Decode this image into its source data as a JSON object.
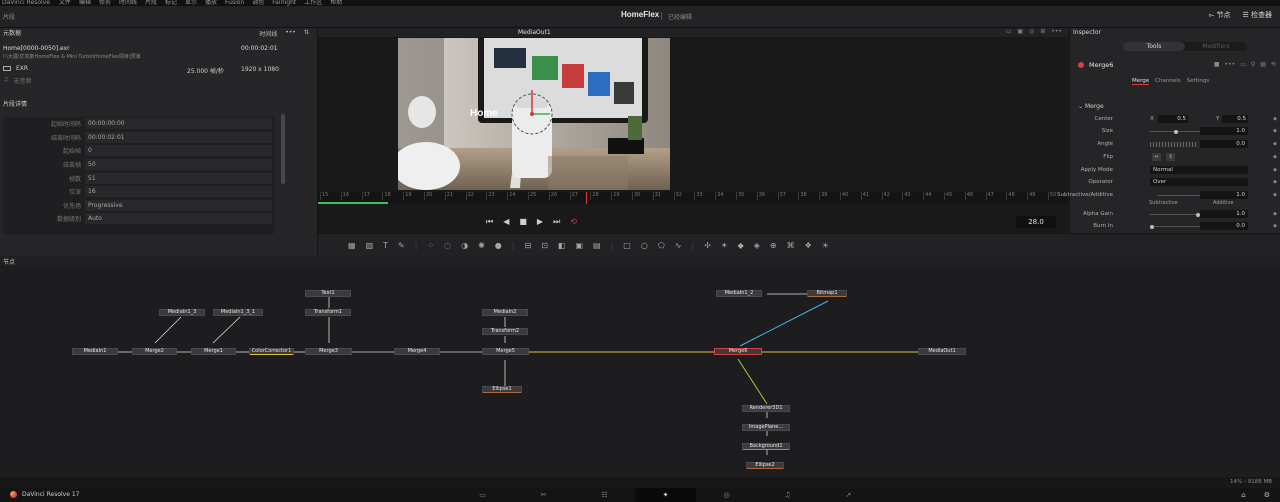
{
  "menubar": {
    "app": "DaVinci Resolve",
    "items": [
      "文件",
      "编辑",
      "修剪",
      "时间线",
      "片段",
      "标记",
      "显示",
      "播放",
      "Fusion",
      "调色",
      "Fairlight",
      "工作区",
      "帮助"
    ]
  },
  "titlebar": {
    "left_label": "片段",
    "project": "HomeFlex",
    "subtitle": "已经编辑",
    "nodes_label": "节点",
    "inspector_label": "检查器"
  },
  "metadata": {
    "title": "元数据",
    "timeline_label": "时间线",
    "clip_name": "Home[0000-0050].exr",
    "clip_timecode": "00:00:02:01",
    "path": "I:\\大疆\\优克斯HomeFlex & Mini Turbo\\HomeFlex项目\\预演",
    "format": "EXR",
    "fps": "25.000 帧/秒",
    "resolution": "1920 x 1080",
    "audio": "无音频",
    "details_title": "片段详情",
    "rows": [
      {
        "k": "起始时间码",
        "v": "00:00:00:00"
      },
      {
        "k": "结束时间码",
        "v": "00:00:02:01"
      },
      {
        "k": "起始帧",
        "v": "0"
      },
      {
        "k": "结束帧",
        "v": "50"
      },
      {
        "k": "帧数",
        "v": "51"
      },
      {
        "k": "位深",
        "v": "16"
      },
      {
        "k": "优先场",
        "v": "Progressive"
      },
      {
        "k": "数据级别",
        "v": "Auto"
      }
    ]
  },
  "viewer": {
    "name": "MediaOut1",
    "overlay_text": "Home",
    "screen_tiles": [
      "CONNECT",
      "",
      "",
      ""
    ],
    "ruler_ticks": [
      "15",
      "16",
      "17",
      "18",
      "19",
      "20",
      "21",
      "22",
      "23",
      "24",
      "25",
      "26",
      "27",
      "28",
      "29",
      "30",
      "31",
      "32",
      "33",
      "34",
      "35",
      "36",
      "37",
      "38",
      "39",
      "40",
      "41",
      "42",
      "43",
      "44",
      "45",
      "46",
      "47",
      "48",
      "49",
      "50"
    ],
    "frame": "28.0"
  },
  "inspector": {
    "title": "Inspector",
    "seg": [
      "Tools",
      "Modifiers"
    ],
    "node": "Merge6",
    "tabs": [
      "Merge",
      "Channels",
      "Settings"
    ],
    "section": "Merge",
    "params": {
      "center_label": "Center",
      "center_x_label": "X",
      "center_x": "0.5",
      "center_y_label": "Y",
      "center_y": "0.5",
      "size_label": "Size",
      "size": "1.0",
      "angle_label": "Angle",
      "angle": "0.0",
      "flip_label": "Flip",
      "apply_label": "Apply Mode",
      "apply": "Normal",
      "operator_label": "Operator",
      "operator": "Over",
      "subadd_label": "Subtractive/Additive",
      "subadd": "1.0",
      "sub_label": "Subtractive",
      "add_label": "Additive",
      "alpha_label": "Alpha Gain",
      "alpha": "1.0",
      "burn_label": "Burn In",
      "burn": "0.0"
    }
  },
  "nodes_panel": {
    "title": "节点",
    "nodes": [
      {
        "id": "MediaIn1",
        "label": "MediaIn1"
      },
      {
        "id": "MediaIn1_3",
        "label": "MediaIn1_3"
      },
      {
        "id": "MediaIn1_3_1",
        "label": "MediaIn1_3_1"
      },
      {
        "id": "Merge2",
        "label": "Merge2"
      },
      {
        "id": "Merge1",
        "label": "Merge1"
      },
      {
        "id": "ColorCorrector1",
        "label": "ColorCorrector1"
      },
      {
        "id": "Text1",
        "label": "Text1"
      },
      {
        "id": "Transform1",
        "label": "Transform1"
      },
      {
        "id": "Merge3",
        "label": "Merge3"
      },
      {
        "id": "Merge4",
        "label": "Merge4"
      },
      {
        "id": "MediaIn2",
        "label": "MediaIn2"
      },
      {
        "id": "Transform2",
        "label": "Transform2"
      },
      {
        "id": "Merge5",
        "label": "Merge5"
      },
      {
        "id": "Ellipse1",
        "label": "Ellipse1"
      },
      {
        "id": "MediaIn1_2",
        "label": "MediaIn1_2"
      },
      {
        "id": "Bitmap1",
        "label": "Bitmap1"
      },
      {
        "id": "Merge6",
        "label": "Merge6"
      },
      {
        "id": "MediaOut1",
        "label": "MediaOut1"
      },
      {
        "id": "Renderer3D1",
        "label": "Renderer3D1"
      },
      {
        "id": "ImagePlane",
        "label": "ImagePlane..."
      },
      {
        "id": "Background1",
        "label": "Background1"
      },
      {
        "id": "Ellipse2",
        "label": "Ellipse2"
      }
    ]
  },
  "status": {
    "memory": "14% - 9188 MB"
  },
  "pagebar": {
    "brand": "DaVinci Resolve 17"
  },
  "colors": {
    "accent": "#d64040",
    "yellow_link": "#e2c43a",
    "blue_link": "#4fb3e8",
    "green_link": "#9ccc3a"
  }
}
